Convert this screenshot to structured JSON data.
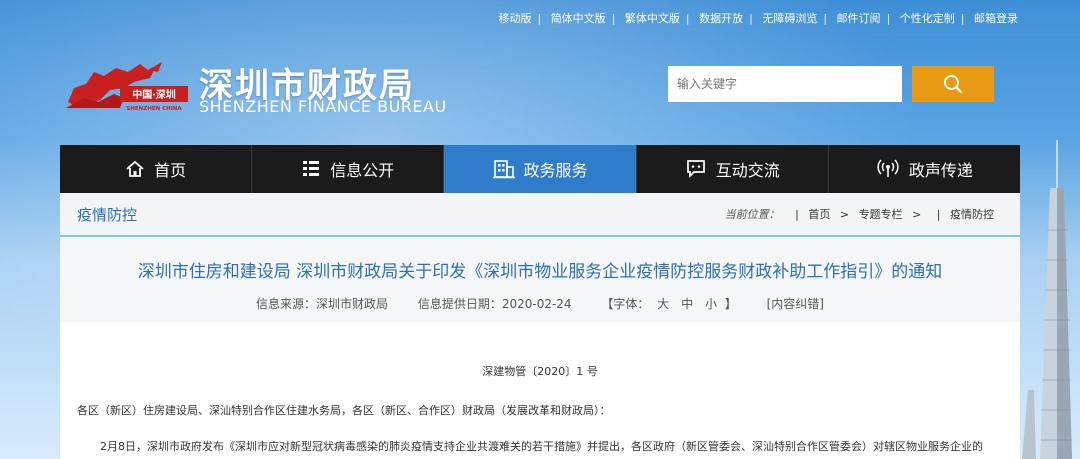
{
  "top_links": [
    "移动版",
    "简体中文版",
    "繁体中文版",
    "数据开放",
    "无障碍浏览",
    "邮件订阅",
    "个性化定制",
    "邮箱登录"
  ],
  "logo": {
    "emblem_text": "中国·深圳",
    "emblem_en": "SHENZHEN CHINA",
    "name_cn": "深圳市财政局",
    "name_en": "SHENZHEN FINANCE BUREAU"
  },
  "search": {
    "placeholder": "输入关键字",
    "icon": "search-icon"
  },
  "nav": [
    {
      "label": "首页",
      "icon": "home-icon"
    },
    {
      "label": "信息公开",
      "icon": "list-icon"
    },
    {
      "label": "政务服务",
      "icon": "building-icon",
      "active": true
    },
    {
      "label": "互动交流",
      "icon": "chat-icon"
    },
    {
      "label": "政声传递",
      "icon": "broadcast-icon"
    }
  ],
  "section_title": "疫情防控",
  "breadcrumb": {
    "label": "当前位置：",
    "items": [
      "首页",
      "专题专栏",
      "疫情防控"
    ],
    "separator": ">"
  },
  "article": {
    "title": "深圳市住房和建设局 深圳市财政局关于印发《深圳市物业服务企业疫情防控服务财政补助工作指引》的通知",
    "source": "信息来源：深圳市财政局",
    "date": "信息提供日期：2020-02-24",
    "font_size_open": "【字体：",
    "font_sizes": [
      "大",
      "中",
      "小"
    ],
    "font_size_close": "】",
    "correction": "[内容纠错]",
    "doc_number": "深建物管〔2020〕1 号",
    "addressee": "各区（新区）住房建设局、深汕特别合作区住建水务局，各区（新区、合作区）财政局（发展改革和财政局）：",
    "para_first": "2月8日，深圳市政府发布《深圳市应对新型冠状病毒感染的肺炎疫情支持企业共渡难关的若干措施》并提出，各区政府（新区管委会、深汕特别合作区管委会）对辖区物业服务企业的"
  },
  "colors": {
    "nav_active": "#2f7ccb",
    "nav_bg": "#1b1b1b",
    "search_button": "#e99a12",
    "title": "#2e6fb6",
    "logo_red": "#c8201e"
  }
}
